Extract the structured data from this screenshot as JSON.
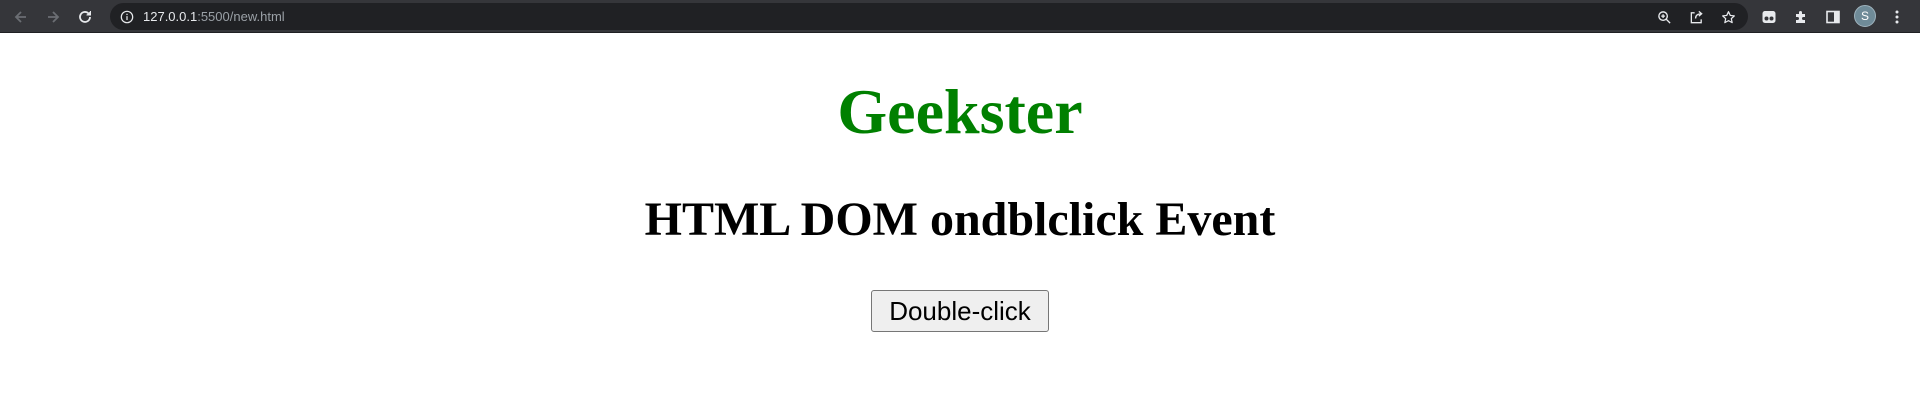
{
  "browser": {
    "url_host": "127.0.0.1",
    "url_rest": ":5500/new.html",
    "profile_initial": "S",
    "icons": {
      "back": "back-arrow-icon",
      "forward": "forward-arrow-icon",
      "reload": "reload-icon",
      "site_info": "info-icon",
      "zoom": "zoom-icon",
      "share": "share-icon",
      "bookmark": "star-icon",
      "extension_1": "extension-badge-icon",
      "extensions": "puzzle-icon",
      "side_panel": "side-panel-icon",
      "menu": "kebab-menu-icon"
    },
    "colors": {
      "toolbar": "#35363a",
      "omnibox": "#202124"
    }
  },
  "page": {
    "title": "Geekster",
    "subtitle": "HTML DOM ondblclick Event",
    "button_label": "Double-click",
    "title_color": "#008000"
  }
}
